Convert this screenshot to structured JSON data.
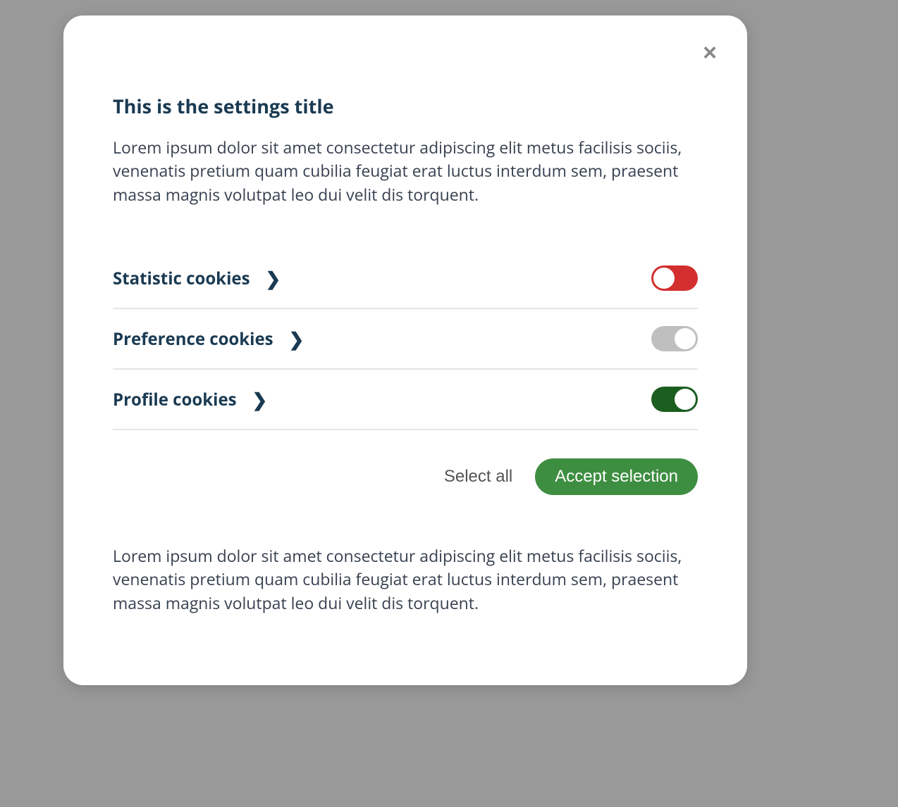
{
  "modal": {
    "title": "This is the settings title",
    "description": "Lorem ipsum dolor sit amet consectetur adipiscing elit metus facilisis sociis, venenatis pretium quam cubilia feugiat erat luctus interdum sem, praesent massa magnis volutpat leo dui velit dis torquent.",
    "footer": "Lorem ipsum dolor sit amet consectetur adipiscing elit metus facilisis sociis, venenatis pretium quam cubilia feugiat erat luctus interdum sem, praesent massa magnis volutpat leo dui velit dis torquent."
  },
  "cookies": [
    {
      "label": "Statistic cookies",
      "state": "on-red",
      "id": "statistic"
    },
    {
      "label": "Preference cookies",
      "state": "off",
      "id": "preference"
    },
    {
      "label": "Profile cookies",
      "state": "on-green",
      "id": "profile"
    }
  ],
  "buttons": {
    "select_all": "Select all",
    "accept": "Accept selection"
  },
  "icons": {
    "close": "×",
    "chevron": "❯"
  },
  "colors": {
    "accent_green": "#3e8e41",
    "toggle_red": "#d32f2f",
    "toggle_green": "#1b5e20",
    "toggle_off": "#bfbfbf",
    "title_color": "#1a3a52"
  }
}
